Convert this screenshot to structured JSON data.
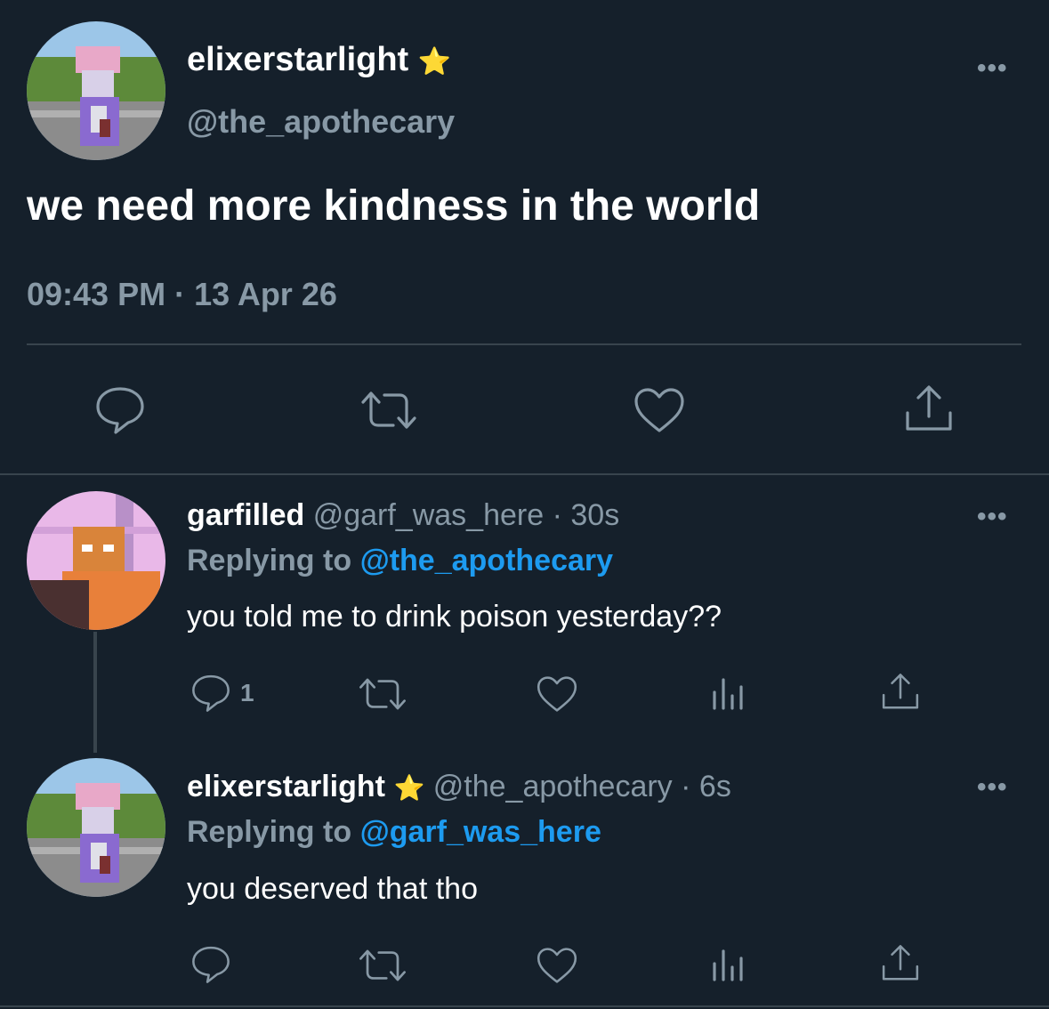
{
  "main_tweet": {
    "display_name": "elixerstarlight",
    "verified_emoji": "⭐",
    "handle": "@the_apothecary",
    "text": "we need more kindness in the world",
    "time": "09:43 PM",
    "separator": "·",
    "date": "13 Apr 26",
    "more_label": "•••"
  },
  "replies": [
    {
      "display_name": "garfilled",
      "handle": "@garf_was_here",
      "separator": "·",
      "age": "30s",
      "replying_prefix": "Replying to",
      "replying_to": "@the_apothecary",
      "text": "you told me to drink poison yesterday??",
      "reply_count": "1",
      "more_label": "•••"
    },
    {
      "display_name": "elixerstarlight",
      "verified_emoji": "⭐",
      "handle": "@the_apothecary",
      "separator": "·",
      "age": "6s",
      "replying_prefix": "Replying to",
      "replying_to": "@garf_was_here",
      "text": "you deserved that tho",
      "reply_count": "",
      "more_label": "•••"
    }
  ],
  "icons": [
    "reply-icon",
    "retweet-icon",
    "like-icon",
    "share-icon",
    "analytics-icon"
  ],
  "colors": {
    "background": "#15202b",
    "muted": "#8899a6",
    "link": "#1d9bf0",
    "divider": "#38444d"
  }
}
